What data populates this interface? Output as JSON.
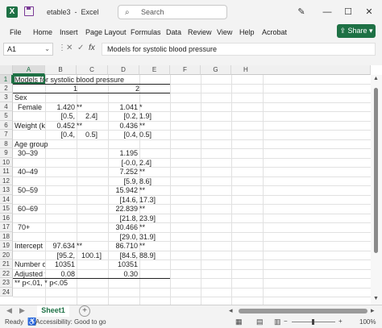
{
  "app": {
    "title": "etable3",
    "app_name": "Excel",
    "search_placeholder": "Search"
  },
  "window_controls": {
    "pen": "✎",
    "minimize": "—",
    "maximize": "☐",
    "close": "✕"
  },
  "menu": [
    "File",
    "Home",
    "Insert",
    "Page Layout",
    "Formulas",
    "Data",
    "Review",
    "View",
    "Help",
    "Acrobat"
  ],
  "share_label": "Share",
  "formula_bar": {
    "name_box": "A1",
    "fx": "fx",
    "content": "Models for systolic blood pressure"
  },
  "columns": [
    "A",
    "B",
    "C",
    "D",
    "E",
    "F",
    "G",
    "H"
  ],
  "rows": [
    "1",
    "2",
    "3",
    "4",
    "5",
    "6",
    "7",
    "8",
    "9",
    "10",
    "11",
    "12",
    "13",
    "14",
    "15",
    "16",
    "17",
    "18",
    "19",
    "20",
    "21",
    "22",
    "23",
    "24"
  ],
  "cells": {
    "title": "Models for systolic blood pressure",
    "col1": "1",
    "col2": "2",
    "r3a": "Sex",
    "r4a": "Female",
    "r4b": "1.420",
    "r4c": "**",
    "r4d": "1.041",
    "r4e": "*",
    "r5b": "[0.5,",
    "r5c": "2.4]",
    "r5d": "[0.2,",
    "r5e": "1.9]",
    "r6a": "Weight (kg",
    "r6b": "0.452",
    "r6c": "**",
    "r6d": "0.436",
    "r6e": "**",
    "r7b": "[0.4,",
    "r7c": "0.5]",
    "r7d": "[0.4,",
    "r7e": "0.5]",
    "r8a": "Age group",
    "r9a": "30–39",
    "r9d": "1.195",
    "r10d": "[-0.0,",
    "r10e": "2.4]",
    "r11a": "40–49",
    "r11d": "7.252",
    "r11e": "**",
    "r12d": "[5.9,",
    "r12e": "8.6]",
    "r13a": "50–59",
    "r13d": "15.942",
    "r13e": "**",
    "r14d": "[14.6,",
    "r14e": "17.3]",
    "r15a": "60–69",
    "r15d": "22.839",
    "r15e": "**",
    "r16d": "[21.8,",
    "r16e": "23.9]",
    "r17a": "70+",
    "r17d": "30.466",
    "r17e": "**",
    "r18d": "[29.0,",
    "r18e": "31.9]",
    "r19a": "Intercept",
    "r19b": "97.634",
    "r19c": "**",
    "r19d": "86.710",
    "r19e": "**",
    "r20b": "[95.2,",
    "r20c": "100.1]",
    "r20d": "[84.5,",
    "r20e": "88.9]",
    "r21a": "Number o",
    "r21b": "10351",
    "r21d": "10351",
    "r22a": "Adjusted f",
    "r22b": "0.08",
    "r22d": "0.30",
    "r23a": "** p<.01, * p<.05"
  },
  "sheet_tab": "Sheet1",
  "add_sheet": "+",
  "status": {
    "ready": "Ready",
    "accessibility": "Accessibility: Good to go",
    "zoom": "100%",
    "zoom_minus": "−",
    "zoom_plus": "+"
  },
  "colors": {
    "accent": "#1e7145"
  }
}
